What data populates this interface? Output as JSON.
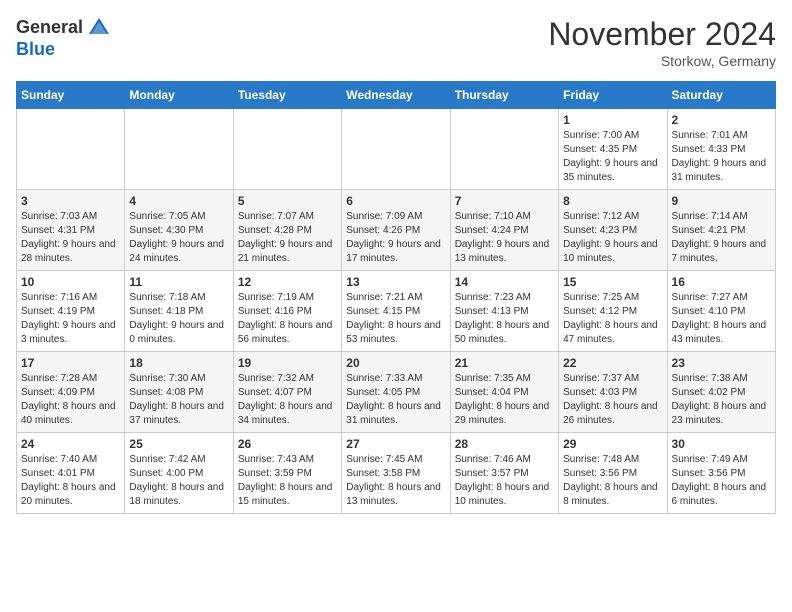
{
  "header": {
    "logo_general": "General",
    "logo_blue": "Blue",
    "month_title": "November 2024",
    "location": "Storkow, Germany"
  },
  "weekdays": [
    "Sunday",
    "Monday",
    "Tuesday",
    "Wednesday",
    "Thursday",
    "Friday",
    "Saturday"
  ],
  "weeks": [
    [
      {
        "day": "",
        "info": ""
      },
      {
        "day": "",
        "info": ""
      },
      {
        "day": "",
        "info": ""
      },
      {
        "day": "",
        "info": ""
      },
      {
        "day": "",
        "info": ""
      },
      {
        "day": "1",
        "info": "Sunrise: 7:00 AM\nSunset: 4:35 PM\nDaylight: 9 hours and 35 minutes."
      },
      {
        "day": "2",
        "info": "Sunrise: 7:01 AM\nSunset: 4:33 PM\nDaylight: 9 hours and 31 minutes."
      }
    ],
    [
      {
        "day": "3",
        "info": "Sunrise: 7:03 AM\nSunset: 4:31 PM\nDaylight: 9 hours and 28 minutes."
      },
      {
        "day": "4",
        "info": "Sunrise: 7:05 AM\nSunset: 4:30 PM\nDaylight: 9 hours and 24 minutes."
      },
      {
        "day": "5",
        "info": "Sunrise: 7:07 AM\nSunset: 4:28 PM\nDaylight: 9 hours and 21 minutes."
      },
      {
        "day": "6",
        "info": "Sunrise: 7:09 AM\nSunset: 4:26 PM\nDaylight: 9 hours and 17 minutes."
      },
      {
        "day": "7",
        "info": "Sunrise: 7:10 AM\nSunset: 4:24 PM\nDaylight: 9 hours and 13 minutes."
      },
      {
        "day": "8",
        "info": "Sunrise: 7:12 AM\nSunset: 4:23 PM\nDaylight: 9 hours and 10 minutes."
      },
      {
        "day": "9",
        "info": "Sunrise: 7:14 AM\nSunset: 4:21 PM\nDaylight: 9 hours and 7 minutes."
      }
    ],
    [
      {
        "day": "10",
        "info": "Sunrise: 7:16 AM\nSunset: 4:19 PM\nDaylight: 9 hours and 3 minutes."
      },
      {
        "day": "11",
        "info": "Sunrise: 7:18 AM\nSunset: 4:18 PM\nDaylight: 9 hours and 0 minutes."
      },
      {
        "day": "12",
        "info": "Sunrise: 7:19 AM\nSunset: 4:16 PM\nDaylight: 8 hours and 56 minutes."
      },
      {
        "day": "13",
        "info": "Sunrise: 7:21 AM\nSunset: 4:15 PM\nDaylight: 8 hours and 53 minutes."
      },
      {
        "day": "14",
        "info": "Sunrise: 7:23 AM\nSunset: 4:13 PM\nDaylight: 8 hours and 50 minutes."
      },
      {
        "day": "15",
        "info": "Sunrise: 7:25 AM\nSunset: 4:12 PM\nDaylight: 8 hours and 47 minutes."
      },
      {
        "day": "16",
        "info": "Sunrise: 7:27 AM\nSunset: 4:10 PM\nDaylight: 8 hours and 43 minutes."
      }
    ],
    [
      {
        "day": "17",
        "info": "Sunrise: 7:28 AM\nSunset: 4:09 PM\nDaylight: 8 hours and 40 minutes."
      },
      {
        "day": "18",
        "info": "Sunrise: 7:30 AM\nSunset: 4:08 PM\nDaylight: 8 hours and 37 minutes."
      },
      {
        "day": "19",
        "info": "Sunrise: 7:32 AM\nSunset: 4:07 PM\nDaylight: 8 hours and 34 minutes."
      },
      {
        "day": "20",
        "info": "Sunrise: 7:33 AM\nSunset: 4:05 PM\nDaylight: 8 hours and 31 minutes."
      },
      {
        "day": "21",
        "info": "Sunrise: 7:35 AM\nSunset: 4:04 PM\nDaylight: 8 hours and 29 minutes."
      },
      {
        "day": "22",
        "info": "Sunrise: 7:37 AM\nSunset: 4:03 PM\nDaylight: 8 hours and 26 minutes."
      },
      {
        "day": "23",
        "info": "Sunrise: 7:38 AM\nSunset: 4:02 PM\nDaylight: 8 hours and 23 minutes."
      }
    ],
    [
      {
        "day": "24",
        "info": "Sunrise: 7:40 AM\nSunset: 4:01 PM\nDaylight: 8 hours and 20 minutes."
      },
      {
        "day": "25",
        "info": "Sunrise: 7:42 AM\nSunset: 4:00 PM\nDaylight: 8 hours and 18 minutes."
      },
      {
        "day": "26",
        "info": "Sunrise: 7:43 AM\nSunset: 3:59 PM\nDaylight: 8 hours and 15 minutes."
      },
      {
        "day": "27",
        "info": "Sunrise: 7:45 AM\nSunset: 3:58 PM\nDaylight: 8 hours and 13 minutes."
      },
      {
        "day": "28",
        "info": "Sunrise: 7:46 AM\nSunset: 3:57 PM\nDaylight: 8 hours and 10 minutes."
      },
      {
        "day": "29",
        "info": "Sunrise: 7:48 AM\nSunset: 3:56 PM\nDaylight: 8 hours and 8 minutes."
      },
      {
        "day": "30",
        "info": "Sunrise: 7:49 AM\nSunset: 3:56 PM\nDaylight: 8 hours and 6 minutes."
      }
    ]
  ]
}
